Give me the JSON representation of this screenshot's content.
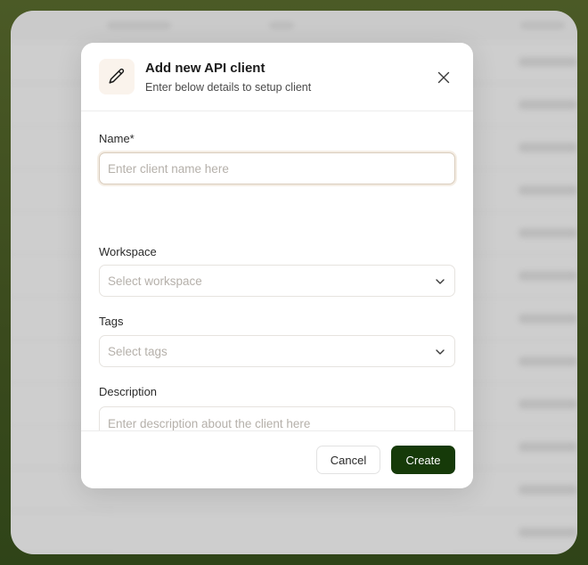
{
  "modal": {
    "title": "Add new API client",
    "subtitle": "Enter below details to setup client",
    "header_icon": "pencil-icon",
    "close_icon": "close-icon"
  },
  "form": {
    "name": {
      "label": "Name*",
      "placeholder": "Enter client name here",
      "value": ""
    },
    "workspace": {
      "label": "Workspace",
      "placeholder": "Select workspace",
      "selected": ""
    },
    "tags": {
      "label": "Tags",
      "placeholder": "Select tags",
      "selected": ""
    },
    "description": {
      "label": "Description",
      "placeholder": "Enter description about the client here",
      "value": ""
    }
  },
  "footer": {
    "cancel_label": "Cancel",
    "create_label": "Create"
  },
  "colors": {
    "primary_button": "#163a09",
    "outer_background": "#3a4a1d",
    "icon_badge_background": "#faf3ec",
    "focus_border": "#d9ccbc"
  }
}
